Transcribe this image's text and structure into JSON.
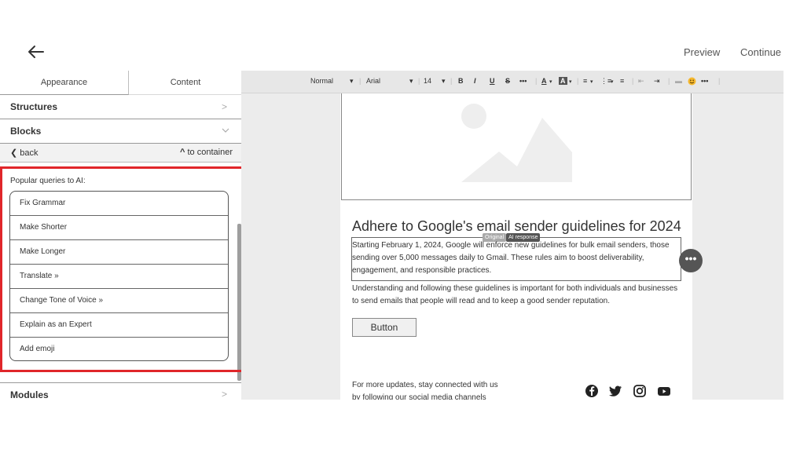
{
  "header": {
    "preview_label": "Preview",
    "continue_label": "Continue"
  },
  "sidebar": {
    "tabs": [
      {
        "label": "Appearance"
      },
      {
        "label": "Content"
      }
    ],
    "structures_label": "Structures",
    "blocks_label": "Blocks",
    "back_label": "back",
    "to_container_label": "to container",
    "ai_panel": {
      "title": "Popular queries to AI:",
      "items": [
        "Fix Grammar",
        "Make Shorter",
        "Make Longer",
        "Translate »",
        "Change Tone of Voice »",
        "Explain as an Expert",
        "Add emoji"
      ]
    },
    "modules_label": "Modules"
  },
  "toolbar": {
    "style_value": "Normal",
    "font_value": "Arial",
    "size_value": "14",
    "bold": "B",
    "italic": "I",
    "underline": "U",
    "strike": "S",
    "more": "•••"
  },
  "email": {
    "heading": "Adhere to Google's email sender guidelines for 2024",
    "pill_original": "Original",
    "pill_ai": "AI response",
    "para1": "Starting February 1, 2024, Google will enforce new guidelines for bulk email senders, those sending over 5,000 messages daily to Gmail. These rules aim to boost deliverability, engagement, and responsible practices.",
    "para2": "Understanding and following these guidelines is important for both individuals and businesses to send emails that people will read and to keep a good sender reputation.",
    "button_label": "Button",
    "footer_line1": "For more updates, stay connected with us",
    "footer_line2": "by following our social media channels",
    "more_button": "•••"
  },
  "colors": {
    "highlight_border": "#e0262a",
    "toolbar_bg": "#e7e7e7",
    "canvas_bg": "#ececec"
  }
}
